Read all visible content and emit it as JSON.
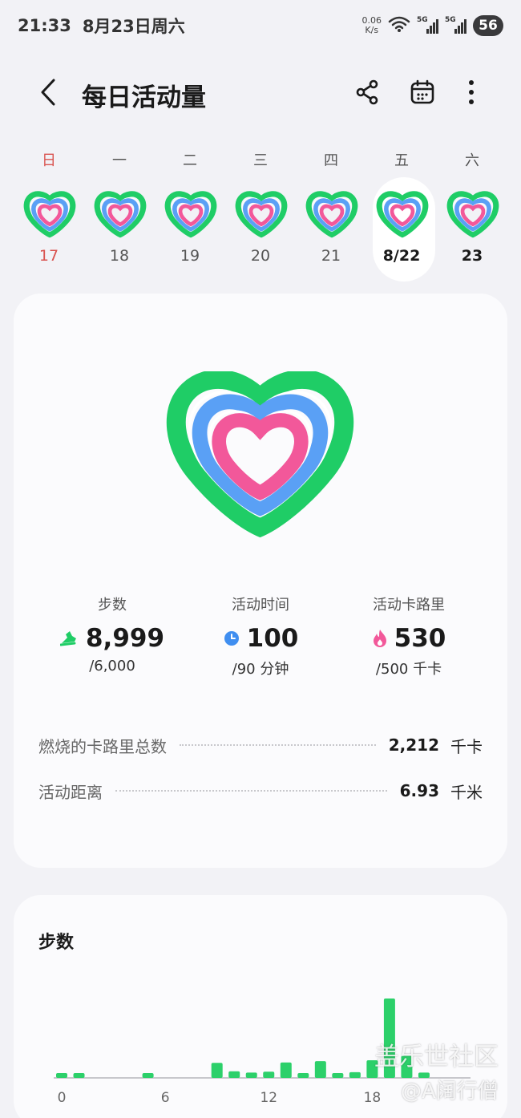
{
  "status": {
    "time": "21:33",
    "date": "8月23日周六",
    "net_speed_value": "0.06",
    "net_speed_unit": "K/s",
    "signal1": "5G",
    "signal2": "5G",
    "battery": "56"
  },
  "header": {
    "title": "每日活动量"
  },
  "week": {
    "days": [
      {
        "weekday": "日",
        "date": "17"
      },
      {
        "weekday": "一",
        "date": "18"
      },
      {
        "weekday": "二",
        "date": "19"
      },
      {
        "weekday": "三",
        "date": "20"
      },
      {
        "weekday": "四",
        "date": "21"
      },
      {
        "weekday": "五",
        "date": "8/22"
      },
      {
        "weekday": "六",
        "date": "23"
      }
    ]
  },
  "summary": {
    "steps": {
      "label": "步数",
      "value": "8,999",
      "goal": "/6,000"
    },
    "active_time": {
      "label": "活动时间",
      "value": "100",
      "goal": "/90 分钟"
    },
    "active_calories": {
      "label": "活动卡路里",
      "value": "530",
      "goal": "/500 千卡"
    },
    "total_burned": {
      "label": "燃烧的卡路里总数",
      "value": "2,212",
      "unit": "千卡"
    },
    "distance": {
      "label": "活动距离",
      "value": "6.93",
      "unit": "千米"
    }
  },
  "steps_section": {
    "title": "步数"
  },
  "chart_data": {
    "type": "bar",
    "title": "步数",
    "x_tick_labels": [
      "0",
      "6",
      "12",
      "18"
    ],
    "x": [
      0,
      1,
      2,
      3,
      4,
      5,
      6,
      7,
      8,
      9,
      10,
      11,
      12,
      13,
      14,
      15,
      16,
      17,
      18,
      19,
      20,
      21,
      22,
      23
    ],
    "values": [
      110,
      110,
      0,
      0,
      0,
      110,
      0,
      0,
      0,
      340,
      150,
      120,
      140,
      350,
      110,
      380,
      110,
      130,
      400,
      1800,
      500,
      120,
      0,
      0
    ],
    "ylim": [
      0,
      2000
    ],
    "color": "#2cd06a"
  },
  "watermark": {
    "line1": "盖乐世社区",
    "line2": "@A阔行僧"
  },
  "colors": {
    "green": "#1fcd66",
    "blue": "#5aa0f5",
    "pink": "#f2589a",
    "sunday_red": "#d9534f"
  }
}
